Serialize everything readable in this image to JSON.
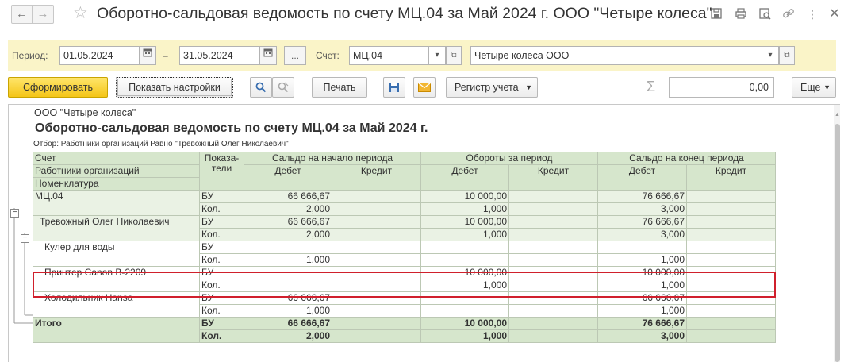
{
  "window": {
    "title": "Оборотно-сальдовая ведомость по счету МЦ.04 за Май 2024 г. ООО \"Четыре колеса\"",
    "icons": [
      "save-icon",
      "print-icon",
      "preview-icon",
      "link-icon",
      "more-icon",
      "close-icon"
    ]
  },
  "filters": {
    "period_label": "Период:",
    "date_from": "01.05.2024",
    "dash": "–",
    "date_to": "31.05.2024",
    "more_button": "...",
    "account_label": "Счет:",
    "account_value": "МЦ.04",
    "org_value": "Четыре колеса ООО"
  },
  "toolbar": {
    "generate": "Сформировать",
    "show_settings": "Показать настройки",
    "print": "Печать",
    "register": "Регистр учета",
    "sum_value": "0,00",
    "more": "Еще"
  },
  "report": {
    "org": "ООО \"Четыре колеса\"",
    "title": "Оборотно-сальдовая ведомость по счету МЦ.04 за Май 2024 г.",
    "filter": "Отбор: Работники организаций Равно \"Тревожный Олег Николаевич\"",
    "headers": {
      "account": "Счет",
      "employees": "Работники организаций",
      "nomenclature": "Номенклатура",
      "indicators": "Показа-\nтели",
      "opening": "Сальдо на начало периода",
      "turnover": "Обороты за период",
      "closing": "Сальдо на конец периода",
      "debit": "Дебет",
      "credit": "Кредит"
    },
    "rows": [
      {
        "name": "МЦ.04",
        "level": 0,
        "lines": [
          {
            "ind": "БУ",
            "od": "66 666,67",
            "oc": "",
            "td": "10 000,00",
            "tc": "",
            "cd": "76 666,67",
            "cc": ""
          },
          {
            "ind": "Кол.",
            "od": "2,000",
            "oc": "",
            "td": "1,000",
            "tc": "",
            "cd": "3,000",
            "cc": ""
          }
        ]
      },
      {
        "name": "Тревожный Олег Николаевич",
        "level": 1,
        "lines": [
          {
            "ind": "БУ",
            "od": "66 666,67",
            "oc": "",
            "td": "10 000,00",
            "tc": "",
            "cd": "76 666,67",
            "cc": ""
          },
          {
            "ind": "Кол.",
            "od": "2,000",
            "oc": "",
            "td": "1,000",
            "tc": "",
            "cd": "3,000",
            "cc": ""
          }
        ]
      },
      {
        "name": "Кулер для воды",
        "level": 2,
        "lines": [
          {
            "ind": "БУ",
            "od": "",
            "oc": "",
            "td": "",
            "tc": "",
            "cd": "",
            "cc": ""
          },
          {
            "ind": "Кол.",
            "od": "1,000",
            "oc": "",
            "td": "",
            "tc": "",
            "cd": "1,000",
            "cc": ""
          }
        ]
      },
      {
        "name": "Принтер Canon B-2209",
        "level": 2,
        "lines": [
          {
            "ind": "БУ",
            "od": "",
            "oc": "",
            "td": "10 000,00",
            "tc": "",
            "cd": "10 000,00",
            "cc": ""
          },
          {
            "ind": "Кол.",
            "od": "",
            "oc": "",
            "td": "1,000",
            "tc": "",
            "cd": "1,000",
            "cc": ""
          }
        ]
      },
      {
        "name": "Холодильник Hansa",
        "level": 2,
        "lines": [
          {
            "ind": "БУ",
            "od": "66 666,67",
            "oc": "",
            "td": "",
            "tc": "",
            "cd": "66 666,67",
            "cc": ""
          },
          {
            "ind": "Кол.",
            "od": "1,000",
            "oc": "",
            "td": "",
            "tc": "",
            "cd": "1,000",
            "cc": ""
          }
        ]
      }
    ],
    "total": {
      "name": "Итого",
      "lines": [
        {
          "ind": "БУ",
          "od": "66 666,67",
          "oc": "",
          "td": "10 000,00",
          "tc": "",
          "cd": "76 666,67",
          "cc": ""
        },
        {
          "ind": "Кол.",
          "od": "2,000",
          "oc": "",
          "td": "1,000",
          "tc": "",
          "cd": "3,000",
          "cc": ""
        }
      ]
    },
    "highlight_color": "#d0202c"
  }
}
